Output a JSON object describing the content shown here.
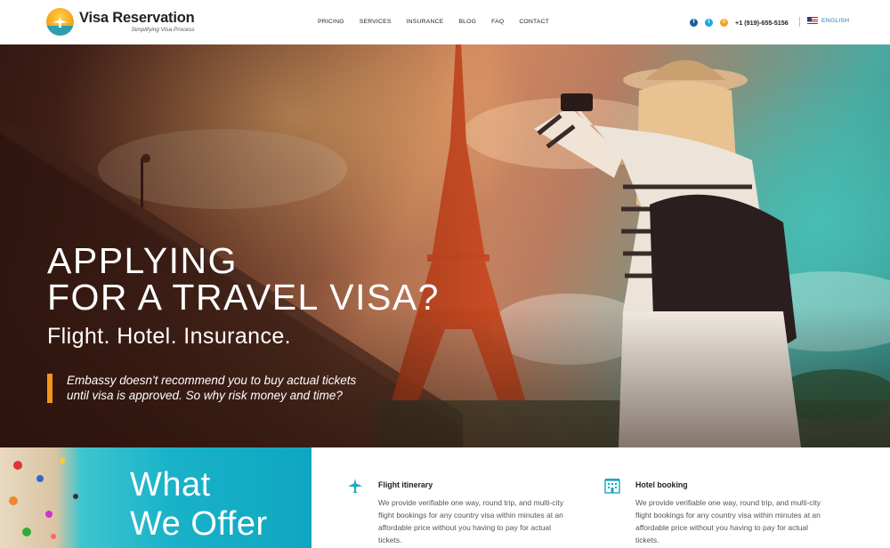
{
  "brand": {
    "name": "Visa Reservation",
    "tagline": "Simplifying Visa Process"
  },
  "nav": {
    "items": [
      "PRICING",
      "SERVICES",
      "INSURANCE",
      "BLOG",
      "FAQ",
      "CONTACT"
    ]
  },
  "contact": {
    "phone": "+1 (919)-655-5156",
    "language": "ENGLISH"
  },
  "hero": {
    "headline_line1": "APPLYING",
    "headline_line2": "FOR A TRAVEL VISA?",
    "subheadline": "Flight. Hotel. Insurance.",
    "quote_line1": "Embassy doesn't recommend you to buy actual tickets",
    "quote_line2": "until visa is approved. So why risk money and time?"
  },
  "offer": {
    "title_line1": "What",
    "title_line2": "We Offer"
  },
  "features": [
    {
      "icon": "airplane-icon",
      "title": "Flight itinerary",
      "description": "We provide verifiable one way, round trip, and multi-city flight bookings for any country visa within minutes at an affordable price without you having to pay for actual tickets."
    },
    {
      "icon": "hotel-icon",
      "title": "Hotel booking",
      "description": "We provide verifiable one way, round trip, and multi-city flight bookings for any country visa within minutes at an affordable price without you having to pay for actual tickets."
    }
  ],
  "colors": {
    "accent": "#f7941d",
    "teal": "#19b2c8",
    "link": "#1e7bb8"
  }
}
